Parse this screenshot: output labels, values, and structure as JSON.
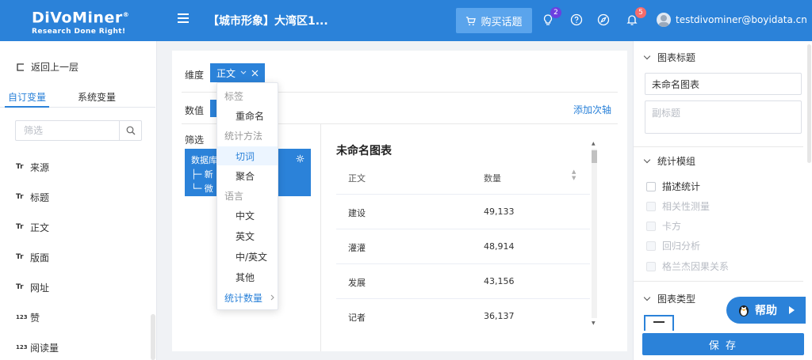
{
  "header": {
    "logo_main": "DiVoMiner",
    "logo_reg": "®",
    "logo_sub": "Research Done Right!",
    "project_title": "【城市形象】大湾区1...",
    "buy_label": "购买话题",
    "badge_bulb": "2",
    "badge_bell": "5",
    "user_email": "testdivominer@boyidata.cn",
    "color_primary": "#2b82d9",
    "color_badge_purple": "#6c3fe0",
    "color_badge_red": "#f56c6c"
  },
  "sidebar": {
    "back_label": "返回上一层",
    "tab_custom": "自订变量",
    "tab_system": "系统变量",
    "filter_placeholder": "筛选",
    "items": [
      {
        "type": "Tr",
        "label": "来源"
      },
      {
        "type": "Tr",
        "label": "标题"
      },
      {
        "type": "Tr",
        "label": "正文"
      },
      {
        "type": "Tr",
        "label": "版面"
      },
      {
        "type": "Tr",
        "label": "网址"
      },
      {
        "type": "123",
        "label": "赞"
      },
      {
        "type": "123",
        "label": "阅读量"
      }
    ]
  },
  "main": {
    "dim_label": "维度",
    "dim_tag": "正文",
    "value_label": "数值",
    "filter_label": "筛选",
    "add_axis": "添加次轴",
    "filter_card": {
      "line1": "数据库",
      "line2": "├─ 新",
      "line3": "└─ 微"
    },
    "chart_title": "未命名图表",
    "table": {
      "headers": [
        "正文",
        "数量"
      ],
      "rows": [
        {
          "term": "建设",
          "count": "49,133"
        },
        {
          "term": "灌灌",
          "count": "48,914"
        },
        {
          "term": "发展",
          "count": "43,156"
        },
        {
          "term": "记者",
          "count": "36,137"
        }
      ]
    }
  },
  "dropdown": {
    "group_label": "标签",
    "rename": "重命名",
    "group_stat": "统计方法",
    "opt_cut": "切词",
    "opt_agg": "聚合",
    "group_lang": "语言",
    "opt_zh": "中文",
    "opt_en": "英文",
    "opt_zhen": "中/英文",
    "opt_other": "其他",
    "stat_count": "统计数量"
  },
  "right": {
    "sec_chart_title": "图表标题",
    "title_value": "未命名图表",
    "subtitle_placeholder": "副标题",
    "sec_stat": "统计模组",
    "cb_desc": "描述统计",
    "cb_corr": "相关性测量",
    "cb_chi": "卡方",
    "cb_reg": "回归分析",
    "cb_granger": "格兰杰因果关系",
    "sec_chart_type": "图表类型",
    "help": "帮助",
    "save": "保 存"
  }
}
